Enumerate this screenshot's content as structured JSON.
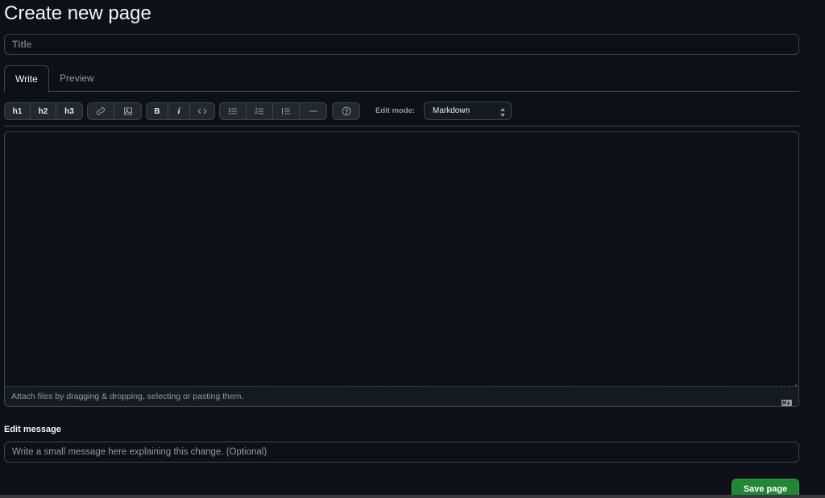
{
  "page": {
    "title": "Create new page",
    "title_placeholder": "Title"
  },
  "tabs": [
    {
      "label": "Write",
      "active": true
    },
    {
      "label": "Preview",
      "active": false
    }
  ],
  "toolbar": {
    "headings": [
      "h1",
      "h2",
      "h3"
    ],
    "insert_icons": [
      "link-icon",
      "image-icon"
    ],
    "format": {
      "bold": "B",
      "italic": "i",
      "code_icon": "code-icon"
    },
    "list_icons": [
      "unordered-list-icon",
      "ordered-list-icon",
      "indent-list-icon",
      "horizontal-rule-icon"
    ],
    "help_icon": "help-icon",
    "edit_mode_label": "Edit mode:",
    "edit_mode_value": "Markdown"
  },
  "editor": {
    "content": "",
    "attach_text": "Attach files by dragging & dropping, selecting or pasting them.",
    "markdown_icon": "markdown-icon"
  },
  "edit_message": {
    "label": "Edit message",
    "placeholder": "Write a small message here explaining this change. (Optional)"
  },
  "save_label": "Save page",
  "colors": {
    "background": "#0d1117",
    "border": "#3d444d",
    "primary_button": "#238636",
    "muted_text": "#9198a1"
  }
}
